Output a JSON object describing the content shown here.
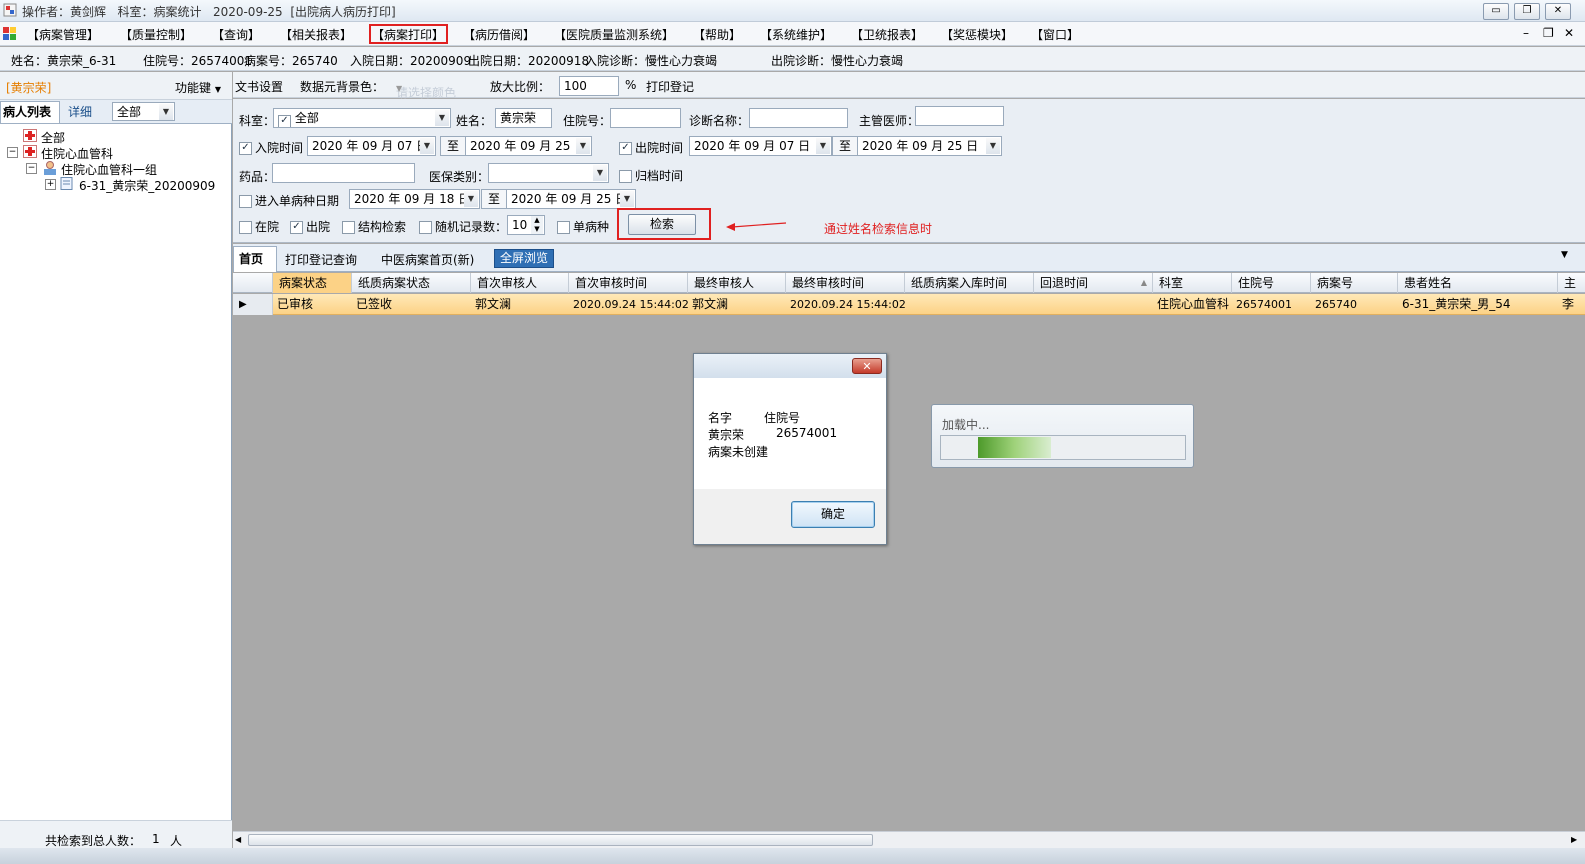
{
  "titlebar": {
    "operator_label": "操作者：黄剑辉",
    "dept_label": "科室：病案统计",
    "date": "2020-09-25",
    "module": "[出院病人病历打印]",
    "btn_min": "▭",
    "btn_restore": "❐",
    "btn_close": "✕"
  },
  "menu": {
    "items": [
      "【病案管理】",
      "【质量控制】",
      "【查询】",
      "【相关报表】",
      "【病案打印】",
      "【病历借阅】",
      "【医院质量监测系统】",
      "【帮助】",
      "【系统维护】",
      "【卫统报表】",
      "【奖惩模块】",
      "【窗口】"
    ],
    "right_min": "–",
    "right_restore": "❐",
    "right_close": "✕"
  },
  "patient_info": {
    "name": "姓名：黄宗荣_6-31",
    "hospital_no": "住院号：26574001",
    "case_no": "病案号：265740",
    "admit_date": "入院日期：20200909",
    "discharge_date": "出院日期：20200918",
    "admit_diag": "入院诊断：慢性心力衰竭",
    "discharge_diag": "出院诊断：慢性心力衰竭"
  },
  "left_panel": {
    "patient_tag": "[黄宗荣]",
    "func_key": "功能键",
    "tab_list": "病人列表",
    "tab_detail": "详细",
    "filter_value": "全部",
    "tree": [
      "全部",
      "住院心血管科",
      "住院心血管科一组",
      "6-31_黄宗荣_20200909"
    ],
    "footer_label": "共检索到总人数：",
    "footer_count": "1",
    "footer_unit": "人"
  },
  "toolbar": {
    "doc_settings": "文书设置",
    "bg_label": "数据元背景色：",
    "bg_placeholder": "请选择颜色",
    "zoom_label": "放大比例：",
    "zoom_value": "100",
    "zoom_unit": "%",
    "print_log": "打印登记"
  },
  "search": {
    "dept_label": "科室：",
    "dept_value": "全部",
    "name_label": "姓名：",
    "name_value": "黄宗荣",
    "hosp_no_label": "住院号：",
    "diag_label": "诊断名称：",
    "doctor_label": "主管医师：",
    "admit_time_label": "入院时间",
    "admit_from": "2020 年 09 月 07 日",
    "to1": "至",
    "admit_to": "2020 年 09 月 25 日",
    "discharge_time_label": "出院时间",
    "discharge_from": "2020 年 09 月 07 日",
    "to2": "至",
    "discharge_to": "2020 年 09 月 25 日",
    "drug_label": "药品：",
    "insurance_label": "医保类别：",
    "archive_label": "归档时间",
    "single_date_label": "进入单病种日期",
    "single_from": "2020 年 09 月 18 日",
    "to3": "至",
    "single_to": "2020 年 09 月 25 日",
    "in_hosp_label": "在院",
    "out_hosp_label": "出院",
    "struct_label": "结构检索",
    "random_label": "随机记录数：",
    "random_value": "10",
    "single_label": "单病种",
    "search_button": "检索",
    "annotation": "通过姓名检索信息时"
  },
  "tabs": [
    "首页",
    "打印登记查询",
    "中医病案首页(新)",
    "全屏浏览"
  ],
  "grid": {
    "columns": [
      "病案状态",
      "纸质病案状态",
      "首次审核人",
      "首次审核时间",
      "最终审核人",
      "最终审核时间",
      "纸质病案入库时间",
      "回退时间",
      "科室",
      "住院号",
      "病案号",
      "患者姓名",
      "主"
    ],
    "row": [
      "已审核",
      "已签收",
      "郭文澜",
      "2020.09.24 15:44:02",
      "郭文澜",
      "2020.09.24 15:44:02",
      "",
      "",
      "住院心血管科",
      "26574001",
      "265740",
      "6-31_黄宗荣_男_54",
      "李"
    ]
  },
  "message_dialog": {
    "header_name": "名字",
    "header_no": "住院号",
    "value_name": "黄宗荣",
    "value_no": "26574001",
    "message": "病案未创建",
    "ok": "确定",
    "close": "✕"
  },
  "loading_dialog": {
    "text": "加载中...",
    "progress": 0.3
  }
}
